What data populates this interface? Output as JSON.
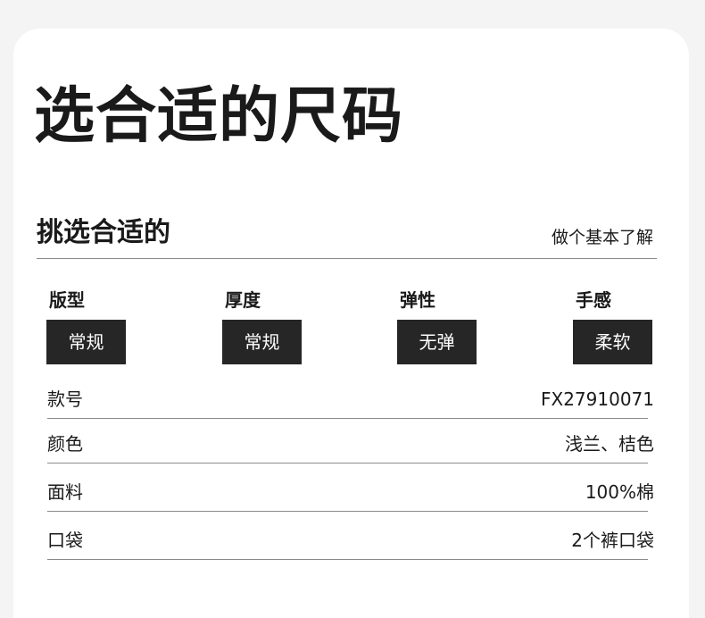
{
  "main_title": "选合适的尺码",
  "section": {
    "title": "挑选合适的",
    "link": "做个基本了解"
  },
  "attributes": [
    {
      "label": "版型",
      "value": "常规"
    },
    {
      "label": "厚度",
      "value": "常规"
    },
    {
      "label": "弹性",
      "value": "无弹"
    },
    {
      "label": "手感",
      "value": "柔软"
    }
  ],
  "info_rows": [
    {
      "label": "款号",
      "value": "FX27910071"
    },
    {
      "label": "颜色",
      "value": "浅兰、桔色"
    },
    {
      "label": "面料",
      "value": "100%棉"
    },
    {
      "label": "口袋",
      "value": "2个裤口袋"
    }
  ]
}
